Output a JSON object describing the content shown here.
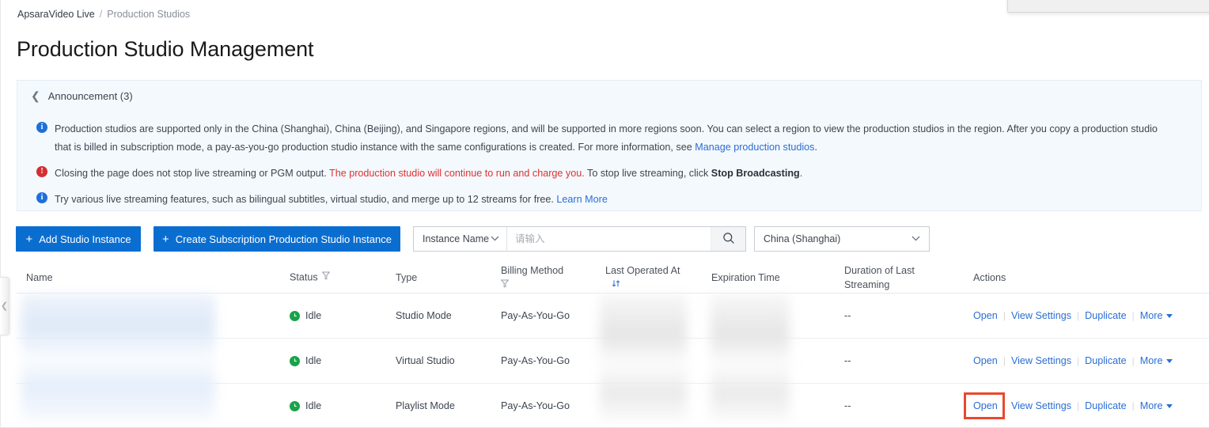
{
  "breadcrumb": {
    "root": "ApsaraVideo Live",
    "separator": "/",
    "current": "Production Studios"
  },
  "page_title": "Production Studio Management",
  "announcement": {
    "label": "Announcement (3)",
    "collapse_icon": "chevron-left-icon",
    "items": [
      {
        "icon": "info-icon",
        "icon_glyph": "i",
        "segments": [
          {
            "type": "text",
            "text": "Production studios are supported only in the China (Shanghai), China (Beijing), and Singapore regions, and will be supported in more regions soon. You can select a region to view the production studios in the region. After you copy a production studio that is billed in subscription mode, a pay-as-you-go production studio instance with the same configurations is created. For more information, see "
          },
          {
            "type": "link",
            "text": "Manage production studios"
          },
          {
            "type": "text",
            "text": "."
          }
        ]
      },
      {
        "icon": "warning-icon",
        "icon_glyph": "!",
        "segments": [
          {
            "type": "text",
            "text": "Closing the page does not stop live streaming or PGM output. "
          },
          {
            "type": "red",
            "text": "The production studio will continue to run and charge you."
          },
          {
            "type": "text",
            "text": " To stop live streaming, click "
          },
          {
            "type": "bold",
            "text": "Stop Broadcasting"
          },
          {
            "type": "text",
            "text": "."
          }
        ]
      },
      {
        "icon": "info-icon",
        "icon_glyph": "i",
        "segments": [
          {
            "type": "text",
            "text": "Try various live streaming features, such as bilingual subtitles, virtual studio, and merge up to 12 streams for free. "
          },
          {
            "type": "link",
            "text": "Learn More"
          }
        ]
      }
    ]
  },
  "toolbar": {
    "add_studio_label": "Add Studio Instance",
    "create_subscription_label": "Create Subscription Production Studio Instance",
    "plus_glyph": "+",
    "search_filter_value": "Instance Name",
    "search_placeholder": "请输入",
    "search_value": "",
    "search_icon": "magnifier-icon",
    "region_value": "China (Shanghai)",
    "chevron_glyph": "⌄"
  },
  "table": {
    "columns": [
      {
        "label": "Name",
        "icon": ""
      },
      {
        "label": "Status",
        "icon": "filter-icon"
      },
      {
        "label": "Type",
        "icon": ""
      },
      {
        "label": "Billing Method",
        "icon": "filter-icon"
      },
      {
        "label": "Last Operated At",
        "icon": "sort-icon"
      },
      {
        "label": "Expiration Time",
        "icon": ""
      },
      {
        "label": "Duration of Last Streaming",
        "icon": ""
      },
      {
        "label": "Actions",
        "icon": ""
      }
    ],
    "rows": [
      {
        "name": "",
        "status": "Idle",
        "status_icon": "clock-icon",
        "type": "Studio Mode",
        "billing_method": "Pay-As-You-Go",
        "last_operated_at": "",
        "expiration_time": "",
        "duration_of_last_streaming": "--"
      },
      {
        "name": "",
        "status": "Idle",
        "status_icon": "clock-icon",
        "type": "Virtual Studio",
        "billing_method": "Pay-As-You-Go",
        "last_operated_at": "",
        "expiration_time": "",
        "duration_of_last_streaming": "--"
      },
      {
        "name": "",
        "status": "Idle",
        "status_icon": "clock-icon",
        "type": "Playlist Mode",
        "billing_method": "Pay-As-You-Go",
        "last_operated_at": "",
        "expiration_time": "",
        "duration_of_last_streaming": "--"
      }
    ],
    "actions": {
      "open": "Open",
      "view_settings": "View Settings",
      "duplicate": "Duplicate",
      "more": "More",
      "separator": "|"
    }
  },
  "colors": {
    "primary_button": "#0a6ed1",
    "link": "#2a6ed4",
    "announcement_bg": "#f4f9fd",
    "warning_red": "#e03131",
    "status_green": "#18a34a",
    "highlight_border": "#e8492c"
  }
}
